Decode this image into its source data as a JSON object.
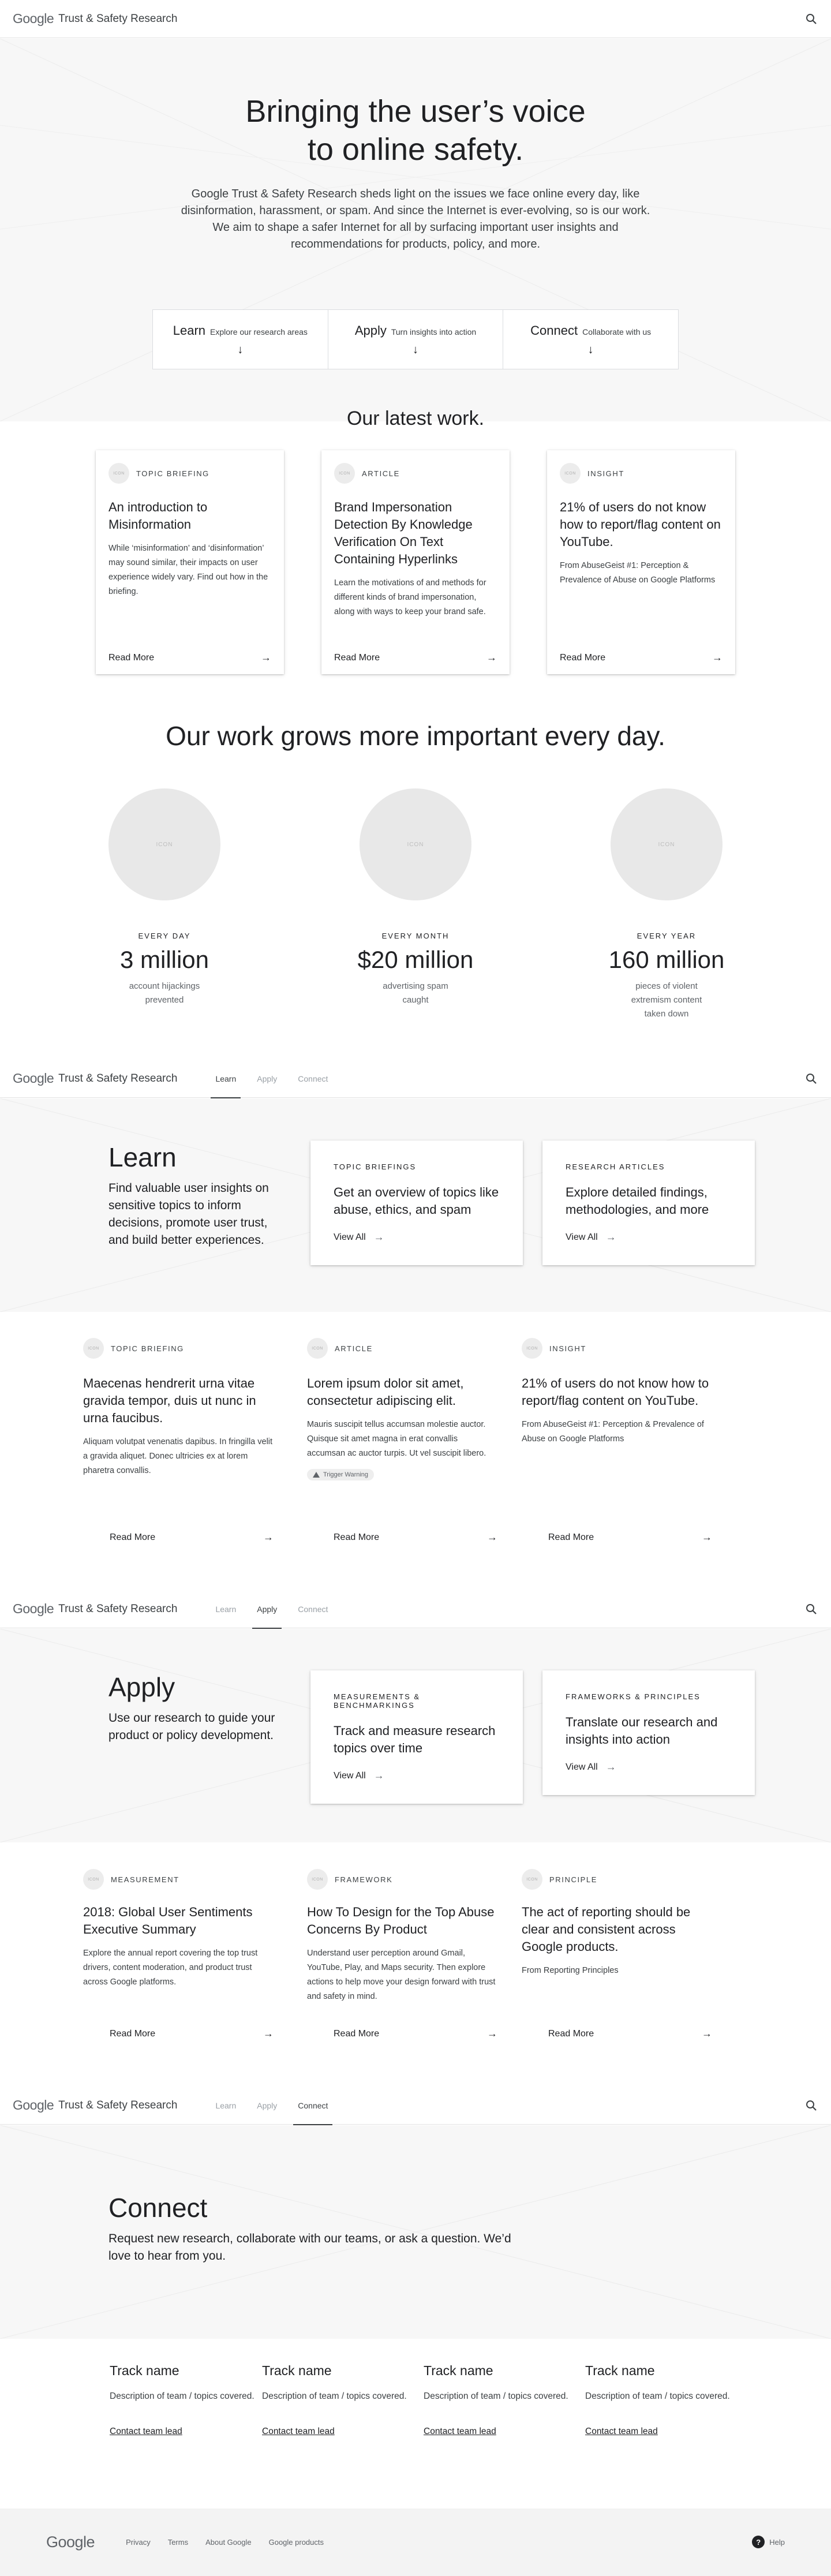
{
  "brand": {
    "logo": "Google",
    "site_name": "Trust & Safety Research"
  },
  "nav": {
    "learn": "Learn",
    "apply": "Apply",
    "connect": "Connect"
  },
  "icons": {
    "search": "search-icon",
    "arrow_down": "arrow-down-icon",
    "arrow_right": "arrow-right-icon",
    "help": "help-icon",
    "warning": "warning-icon"
  },
  "placeholder_icon_text": "ICON",
  "hero": {
    "title_line1": "Bringing the user’s voice",
    "title_line2": "to online safety.",
    "text": "Google Trust & Safety Research sheds light on the issues we face online every day, like disinformation, harassment, or spam.  And since the Internet is ever-evolving, so is our work. We aim to shape a safer Internet for all by surfacing important user insights and recommendations for products, policy, and more."
  },
  "ctas": [
    {
      "title": "Learn",
      "sub": "Explore our research areas",
      "arrow": "↓"
    },
    {
      "title": "Apply",
      "sub": "Turn insights into action",
      "arrow": "↓"
    },
    {
      "title": "Connect",
      "sub": "Collaborate with us",
      "arrow": "↓"
    }
  ],
  "latest": {
    "title": "Our latest work.",
    "cards": [
      {
        "kicker": "TOPIC BRIEFING",
        "title": "An introduction to Misinformation",
        "body": "While ‘misinformation’ and ‘disinformation’ may sound similar, their impacts on user experience widely vary. Find out how in the briefing.",
        "cta": "Read More"
      },
      {
        "kicker": "ARTICLE",
        "title": "Brand Impersonation Detection By Knowledge Verification On Text Containing Hyperlinks",
        "body": "Learn the motivations of and methods for different kinds of brand impersonation, along with ways to keep your brand safe.",
        "cta": "Read More"
      },
      {
        "kicker": "INSIGHT",
        "title": "21% of users do not know how to report/flag content on YouTube.",
        "body": "From AbuseGeist #1: Perception & Prevalence of Abuse on Google Platforms",
        "cta": "Read More"
      }
    ]
  },
  "stats": {
    "title": "Our work grows more important every day.",
    "items": [
      {
        "kicker": "EVERY DAY",
        "value": "3 million",
        "desc": "account hijackings prevented"
      },
      {
        "kicker": "EVERY MONTH",
        "value": "$20 million",
        "desc": "advertising spam caught"
      },
      {
        "kicker": "EVERY YEAR",
        "value": "160 million",
        "desc": "pieces of violent extremism content taken down"
      }
    ]
  },
  "learn": {
    "title": "Learn",
    "desc": "Find valuable user insights on sensitive topics to inform decisions, promote user trust, and build better experiences.",
    "boxes": [
      {
        "kicker": "TOPIC BRIEFINGS",
        "title": "Get an overview of topics like abuse, ethics, and spam",
        "cta": "View All"
      },
      {
        "kicker": "RESEARCH ARTICLES",
        "title": "Explore detailed findings, methodologies, and more",
        "cta": "View All"
      }
    ],
    "cards": [
      {
        "kicker": "TOPIC BRIEFING",
        "title": "Maecenas hendrerit urna vitae gravida tempor, duis ut nunc in urna faucibus.",
        "body": "Aliquam volutpat venenatis dapibus. In fringilla velit a gravida aliquet. Donec ultricies ex at lorem pharetra convallis.",
        "cta": "Read More"
      },
      {
        "kicker": "ARTICLE",
        "title": "Lorem ipsum dolor sit amet, consectetur adipiscing elit.",
        "body": "Mauris suscipit tellus accumsan molestie auctor. Quisque sit amet magna in erat convallis accumsan ac auctor turpis. Ut vel suscipit libero.",
        "chip": "Trigger Warning",
        "cta": "Read More"
      },
      {
        "kicker": "INSIGHT",
        "title": "21% of users do not know how to report/flag content on YouTube.",
        "body": "From AbuseGeist #1: Perception & Prevalence of Abuse on Google Platforms",
        "cta": "Read More"
      }
    ]
  },
  "apply": {
    "title": "Apply",
    "desc": "Use our research to guide your product or policy development.",
    "boxes": [
      {
        "kicker": "MEASUREMENTS & BENCHMARKINGS",
        "title": "Track and measure research topics over time",
        "cta": "View All"
      },
      {
        "kicker": "FRAMEWORKS & PRINCIPLES",
        "title": "Translate our research and insights into action",
        "cta": "View All"
      }
    ],
    "cards": [
      {
        "kicker": "MEASUREMENT",
        "title": "2018: Global User Sentiments Executive Summary",
        "body": "Explore the annual report covering the top trust drivers, content moderation, and product trust across Google platforms.",
        "cta": "Read More"
      },
      {
        "kicker": "FRAMEWORK",
        "title": "How To Design for the Top Abuse Concerns By Product",
        "body": "Understand user perception around Gmail, YouTube, Play, and Maps security. Then explore actions to help move your design forward with trust and safety in mind.",
        "cta": "Read More"
      },
      {
        "kicker": "PRINCIPLE",
        "title": "The act of reporting should be clear and consistent across Google products.",
        "body": "From Reporting Principles",
        "cta": "Read More"
      }
    ]
  },
  "connect": {
    "title": "Connect",
    "desc": "Request new research, collaborate with our teams, or ask a question. We’d love to hear from you.",
    "tracks": [
      {
        "name": "Track name",
        "desc": "Description of team / topics covered.",
        "link": "Contact team lead"
      },
      {
        "name": "Track name",
        "desc": "Description of team / topics covered.",
        "link": "Contact team lead"
      },
      {
        "name": "Track name",
        "desc": "Description of team / topics covered.",
        "link": "Contact team lead"
      },
      {
        "name": "Track name",
        "desc": "Description of team / topics covered.",
        "link": "Contact team lead"
      }
    ]
  },
  "footer": {
    "logo": "Google",
    "links": [
      "Privacy",
      "Terms",
      "About Google",
      "Google products"
    ],
    "help": "Help",
    "help_glyph": "?"
  }
}
